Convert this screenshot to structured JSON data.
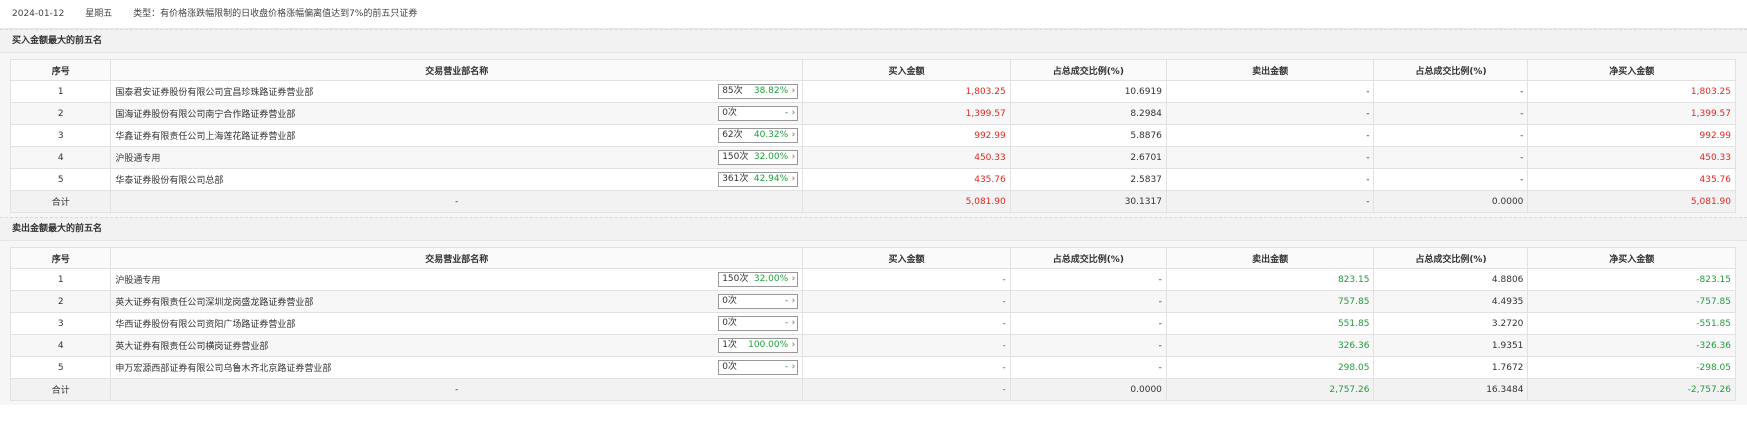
{
  "header": {
    "date": "2024-01-12",
    "weekday": "星期五",
    "type_text": "类型：有价格涨跌幅限制的日收盘价格涨幅偏离值达到7%的前五只证券"
  },
  "colors": {
    "up": "#e8251f",
    "down": "#1e9e3a",
    "icon": "chevron-right-icon"
  },
  "columns": [
    "序号",
    "交易营业部名称",
    "买入金额",
    "占总成交比例(%)",
    "卖出金额",
    "占总成交比例(%)",
    "净买入金额"
  ],
  "buy_section": {
    "title": "买入金额最大的前五名",
    "rows": [
      {
        "idx": "1",
        "name": "国泰君安证券股份有限公司宜昌珍珠路证券营业部",
        "count": "85次",
        "pct": "38.82%",
        "buy": "1,803.25",
        "buy_ratio": "10.6919",
        "sell": "-",
        "sell_ratio": "-",
        "net": "1,803.25"
      },
      {
        "idx": "2",
        "name": "国海证券股份有限公司南宁合作路证券营业部",
        "count": "0次",
        "pct": "-",
        "buy": "1,399.57",
        "buy_ratio": "8.2984",
        "sell": "-",
        "sell_ratio": "-",
        "net": "1,399.57"
      },
      {
        "idx": "3",
        "name": "华鑫证券有限责任公司上海莲花路证券营业部",
        "count": "62次",
        "pct": "40.32%",
        "buy": "992.99",
        "buy_ratio": "5.8876",
        "sell": "-",
        "sell_ratio": "-",
        "net": "992.99"
      },
      {
        "idx": "4",
        "name": "沪股通专用",
        "count": "150次",
        "pct": "32.00%",
        "buy": "450.33",
        "buy_ratio": "2.6701",
        "sell": "-",
        "sell_ratio": "-",
        "net": "450.33"
      },
      {
        "idx": "5",
        "name": "华泰证券股份有限公司总部",
        "count": "361次",
        "pct": "42.94%",
        "buy": "435.76",
        "buy_ratio": "2.5837",
        "sell": "-",
        "sell_ratio": "-",
        "net": "435.76"
      }
    ],
    "total": {
      "label": "合计",
      "name": "-",
      "buy": "5,081.90",
      "buy_ratio": "30.1317",
      "sell": "-",
      "sell_ratio": "0.0000",
      "net": "5,081.90"
    }
  },
  "sell_section": {
    "title": "卖出金额最大的前五名",
    "rows": [
      {
        "idx": "1",
        "name": "沪股通专用",
        "count": "150次",
        "pct": "32.00%",
        "buy": "-",
        "buy_ratio": "-",
        "sell": "823.15",
        "sell_ratio": "4.8806",
        "net": "-823.15"
      },
      {
        "idx": "2",
        "name": "英大证券有限责任公司深圳龙岗盛龙路证券营业部",
        "count": "0次",
        "pct": "-",
        "buy": "-",
        "buy_ratio": "-",
        "sell": "757.85",
        "sell_ratio": "4.4935",
        "net": "-757.85"
      },
      {
        "idx": "3",
        "name": "华西证券股份有限公司资阳广场路证券营业部",
        "count": "0次",
        "pct": "-",
        "buy": "-",
        "buy_ratio": "-",
        "sell": "551.85",
        "sell_ratio": "3.2720",
        "net": "-551.85"
      },
      {
        "idx": "4",
        "name": "英大证券有限责任公司横岗证券营业部",
        "count": "1次",
        "pct": "100.00%",
        "buy": "-",
        "buy_ratio": "-",
        "sell": "326.36",
        "sell_ratio": "1.9351",
        "net": "-326.36"
      },
      {
        "idx": "5",
        "name": "申万宏源西部证券有限公司乌鲁木齐北京路证券营业部",
        "count": "0次",
        "pct": "-",
        "buy": "-",
        "buy_ratio": "-",
        "sell": "298.05",
        "sell_ratio": "1.7672",
        "net": "-298.05"
      }
    ],
    "total": {
      "label": "合计",
      "name": "-",
      "buy": "-",
      "buy_ratio": "0.0000",
      "sell": "2,757.26",
      "sell_ratio": "16.3484",
      "net": "-2,757.26"
    }
  }
}
